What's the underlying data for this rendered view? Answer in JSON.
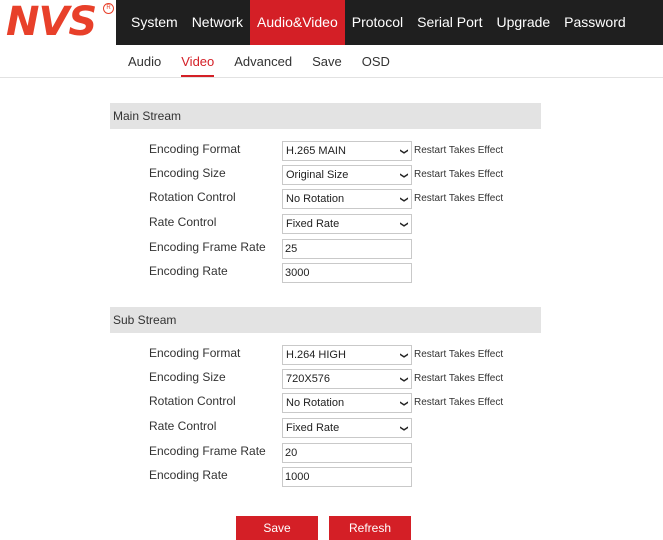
{
  "brand": {
    "logo_text": "NVS",
    "registered": "R",
    "accent_color": "#d41f26"
  },
  "main_nav": [
    {
      "label": "System",
      "active": false
    },
    {
      "label": "Network",
      "active": false
    },
    {
      "label": "Audio&Video",
      "active": true
    },
    {
      "label": "Protocol",
      "active": false
    },
    {
      "label": "Serial Port",
      "active": false
    },
    {
      "label": "Upgrade",
      "active": false
    },
    {
      "label": "Password",
      "active": false
    }
  ],
  "sub_nav": [
    {
      "label": "Audio",
      "active": false
    },
    {
      "label": "Video",
      "active": true
    },
    {
      "label": "Advanced",
      "active": false
    },
    {
      "label": "Save",
      "active": false
    },
    {
      "label": "OSD",
      "active": false
    }
  ],
  "main_stream": {
    "title": "Main Stream",
    "encoding_format": {
      "label": "Encoding Format",
      "value": "H.265 MAIN",
      "note": "Restart Takes Effect"
    },
    "encoding_size": {
      "label": "Encoding Size",
      "value": "Original Size",
      "note": "Restart Takes Effect"
    },
    "rotation_control": {
      "label": "Rotation Control",
      "value": "No Rotation",
      "note": "Restart Takes Effect"
    },
    "rate_control": {
      "label": "Rate Control",
      "value": "Fixed Rate"
    },
    "frame_rate": {
      "label": "Encoding Frame Rate",
      "value": "25"
    },
    "encoding_rate": {
      "label": "Encoding Rate",
      "value": "3000"
    }
  },
  "sub_stream": {
    "title": "Sub Stream",
    "encoding_format": {
      "label": "Encoding Format",
      "value": "H.264 HIGH",
      "note": "Restart Takes Effect"
    },
    "encoding_size": {
      "label": "Encoding Size",
      "value": "720X576",
      "note": "Restart Takes Effect"
    },
    "rotation_control": {
      "label": "Rotation Control",
      "value": "No Rotation",
      "note": "Restart Takes Effect"
    },
    "rate_control": {
      "label": "Rate Control",
      "value": "Fixed Rate"
    },
    "frame_rate": {
      "label": "Encoding Frame Rate",
      "value": "20"
    },
    "encoding_rate": {
      "label": "Encoding Rate",
      "value": "1000"
    }
  },
  "buttons": {
    "save": "Save",
    "refresh": "Refresh"
  }
}
